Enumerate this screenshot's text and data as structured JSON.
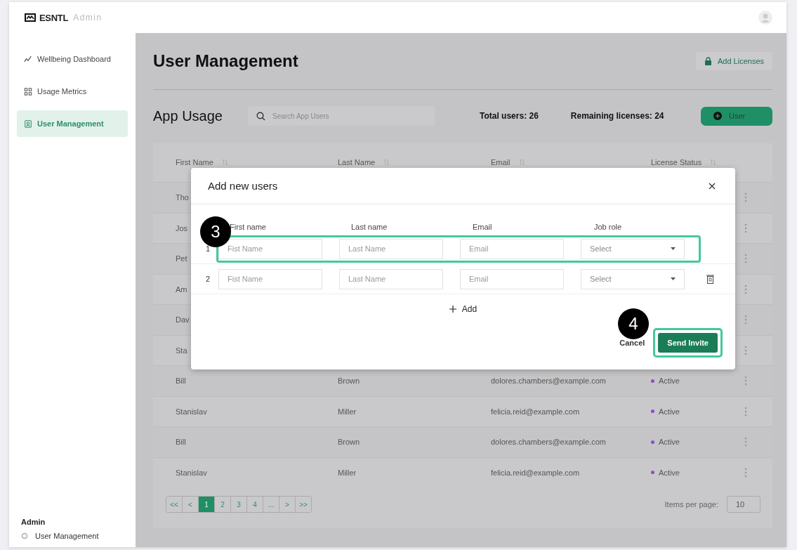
{
  "brand": {
    "name": "ESNTL",
    "suffix": "Admin"
  },
  "sidebar": {
    "items": [
      {
        "label": "Wellbeing Dashboard",
        "kind": "chart",
        "selected": false
      },
      {
        "label": "Usage Metrics",
        "kind": "grid",
        "selected": false
      },
      {
        "label": "User Management",
        "kind": "user",
        "selected": true
      }
    ],
    "footer": {
      "heading": "Admin",
      "item": "User Management"
    }
  },
  "header": {
    "title": "User Management",
    "add_licenses": "Add Licenses"
  },
  "app_usage": {
    "title": "App Usage",
    "search_placeholder": "Search App Users",
    "total": "Total users: 26",
    "remaining": "Remaining licenses: 24",
    "add_user": "User"
  },
  "table": {
    "columns": [
      "First Name",
      "Last Name",
      "Email",
      "License Status"
    ],
    "rows": [
      {
        "first": "Tho"
      },
      {
        "first": "Jos"
      },
      {
        "first": "Pet"
      },
      {
        "first": "Am"
      },
      {
        "first": "Dav"
      },
      {
        "first": "Sta"
      },
      {
        "first": "Bill",
        "last": "Brown",
        "email": "dolores.chambers@example.com",
        "status": "Active"
      },
      {
        "first": "Stanislav",
        "last": "Miller",
        "email": "felicia.reid@example.com",
        "status": "Active"
      },
      {
        "first": "Bill",
        "last": "Brown",
        "email": "dolores.chambers@example.com",
        "status": "Active"
      },
      {
        "first": "Stanislav",
        "last": "Miller",
        "email": "felicia.reid@example.com",
        "status": "Active"
      }
    ]
  },
  "pagination": {
    "pages": [
      {
        "label": "<<",
        "selected": false
      },
      {
        "label": "<",
        "selected": false
      },
      {
        "label": "1",
        "selected": true
      },
      {
        "label": "2",
        "selected": false
      },
      {
        "label": "3",
        "selected": false
      },
      {
        "label": "4",
        "selected": false
      },
      {
        "label": "...",
        "selected": false
      },
      {
        "label": ">",
        "selected": false
      },
      {
        "label": ">>",
        "selected": false
      }
    ],
    "items_per_page_label": "Items per page:",
    "items_per_page": "10"
  },
  "modal": {
    "title": "Add new users",
    "columns": [
      "First name",
      "Last name",
      "Email",
      "Job role"
    ],
    "rows": [
      {
        "number": "1",
        "first_placeholder": "Fist Name",
        "last_placeholder": "Last Name",
        "email_placeholder": "Email",
        "role": "Select",
        "deletable": false,
        "highlighted": true
      },
      {
        "number": "2",
        "first_placeholder": "Fist Name",
        "last_placeholder": "Last Name",
        "email_placeholder": "Email",
        "role": "Select",
        "deletable": true,
        "highlighted": false
      }
    ],
    "add": "Add",
    "cancel": "Cancel",
    "send": "Send Invite",
    "send_highlighted": true
  },
  "annotations": [
    {
      "label": "3"
    },
    {
      "label": "4"
    }
  ]
}
